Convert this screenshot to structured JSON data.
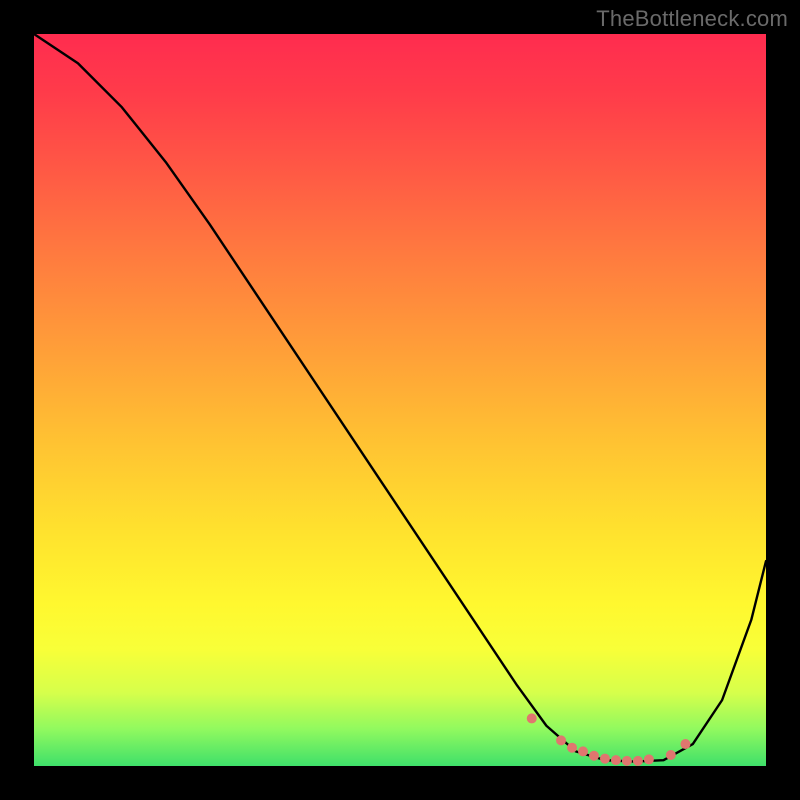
{
  "chart_data": {
    "type": "line",
    "watermark": "TheBottleneck.com",
    "plot_size": 732,
    "x_range": [
      0,
      100
    ],
    "y_range": [
      0,
      100
    ],
    "title": "",
    "xlabel": "",
    "ylabel": "",
    "legend": false,
    "grid": false,
    "series": [
      {
        "name": "bottleneck",
        "x": [
          0,
          6,
          12,
          18,
          24,
          30,
          36,
          42,
          48,
          54,
          60,
          66,
          70,
          74,
          78,
          82,
          86,
          90,
          94,
          98,
          100
        ],
        "y": [
          100,
          96,
          90,
          82.5,
          74,
          65,
          56,
          47,
          38,
          29,
          20,
          11,
          5.5,
          2,
          0.8,
          0.6,
          0.8,
          3,
          9,
          20,
          28
        ]
      }
    ],
    "optimal_zone": {
      "comment": "flat-bottom dots shown on the curve",
      "points": [
        {
          "x": 68,
          "y": 6.5
        },
        {
          "x": 72,
          "y": 3.5
        },
        {
          "x": 73.5,
          "y": 2.5
        },
        {
          "x": 75,
          "y": 2.0
        },
        {
          "x": 76.5,
          "y": 1.4
        },
        {
          "x": 78,
          "y": 1.0
        },
        {
          "x": 79.5,
          "y": 0.8
        },
        {
          "x": 81,
          "y": 0.7
        },
        {
          "x": 82.5,
          "y": 0.7
        },
        {
          "x": 84,
          "y": 0.9
        },
        {
          "x": 87,
          "y": 1.5
        },
        {
          "x": 89,
          "y": 3.0
        }
      ],
      "dot_color": "#e0766f",
      "dot_radius": 5
    }
  }
}
